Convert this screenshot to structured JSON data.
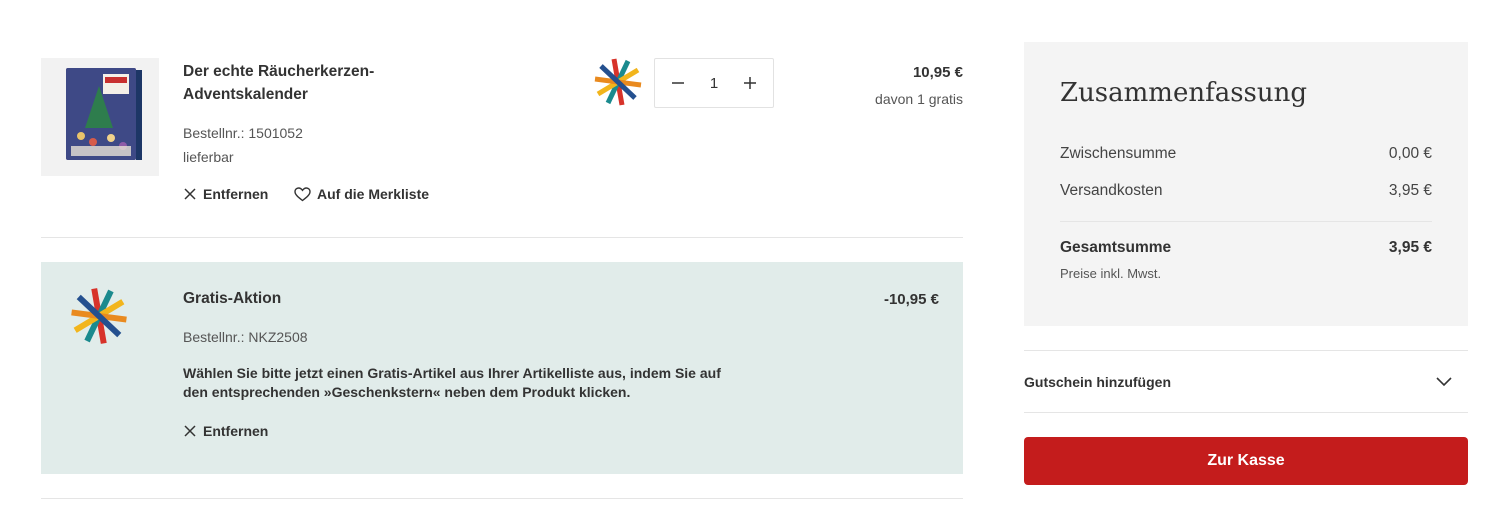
{
  "cart_item": {
    "title": "Der echte Räucherkerzen-Adventskalender",
    "order_number": "Bestellnr.: 1501052",
    "availability": "lieferbar",
    "remove_label": "Entfernen",
    "wishlist_label": "Auf die Merkliste",
    "quantity": "1",
    "price": "10,95 €",
    "price_note": "davon 1 gratis",
    "image_icon": "advent-calendar-product-image"
  },
  "promo": {
    "title": "Gratis-Aktion",
    "order_number": "Bestellnr.: NKZ2508",
    "description": "Wählen Sie bitte jetzt einen Gratis-Artikel aus Ihrer Artikelliste aus, indem Sie auf den entsprechenden »Geschenkstern« neben dem Produkt klicken.",
    "remove_label": "Entfernen",
    "price": "-10,95 €",
    "background": "#e1ecea"
  },
  "summary": {
    "title": "Zusammenfassung",
    "subtotal_label": "Zwischensumme",
    "subtotal_value": "0,00 €",
    "shipping_label": "Versandkosten",
    "shipping_value": "3,95 €",
    "total_label": "Gesamtsumme",
    "total_value": "3,95 €",
    "tax_note": "Preise inkl. Mwst."
  },
  "voucher": {
    "label": "Gutschein hinzufügen",
    "icon": "chevron-down-icon"
  },
  "checkout": {
    "label": "Zur Kasse",
    "color": "#c41c1c"
  },
  "colors": {
    "star_red": "#d7332a",
    "star_orange": "#e98a1f",
    "star_yellow": "#f2b51c",
    "star_teal": "#1a8a8e",
    "star_blue": "#24508f"
  }
}
